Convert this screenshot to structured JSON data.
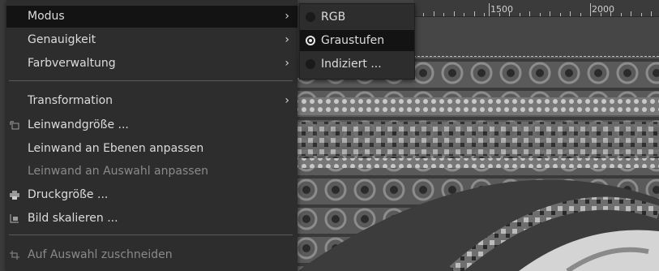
{
  "ruler": {
    "marks": [
      "1500",
      "2000"
    ]
  },
  "menu": {
    "items": [
      {
        "label": "Modus",
        "has_submenu": true,
        "highlighted": true
      },
      {
        "label": "Genauigkeit",
        "has_submenu": true
      },
      {
        "label": "Farbverwaltung",
        "has_submenu": true
      },
      {
        "label": "Transformation",
        "has_submenu": true
      },
      {
        "label": "Leinwandgröße ...",
        "icon": "canvas-size-icon"
      },
      {
        "label": "Leinwand an Ebenen anpassen"
      },
      {
        "label": "Leinwand an Auswahl anpassen",
        "disabled": true
      },
      {
        "label": "Druckgröße ...",
        "icon": "printer-icon"
      },
      {
        "label": "Bild skalieren ...",
        "icon": "scale-image-icon"
      },
      {
        "label": "Auf Auswahl zuschneiden",
        "disabled": true,
        "icon": "crop-icon"
      }
    ],
    "arrow": "›"
  },
  "submenu": {
    "items": [
      {
        "label": "RGB",
        "selected": false
      },
      {
        "label": "Graustufen",
        "selected": true,
        "highlighted": true
      },
      {
        "label": "Indiziert ...",
        "selected": false
      }
    ]
  }
}
